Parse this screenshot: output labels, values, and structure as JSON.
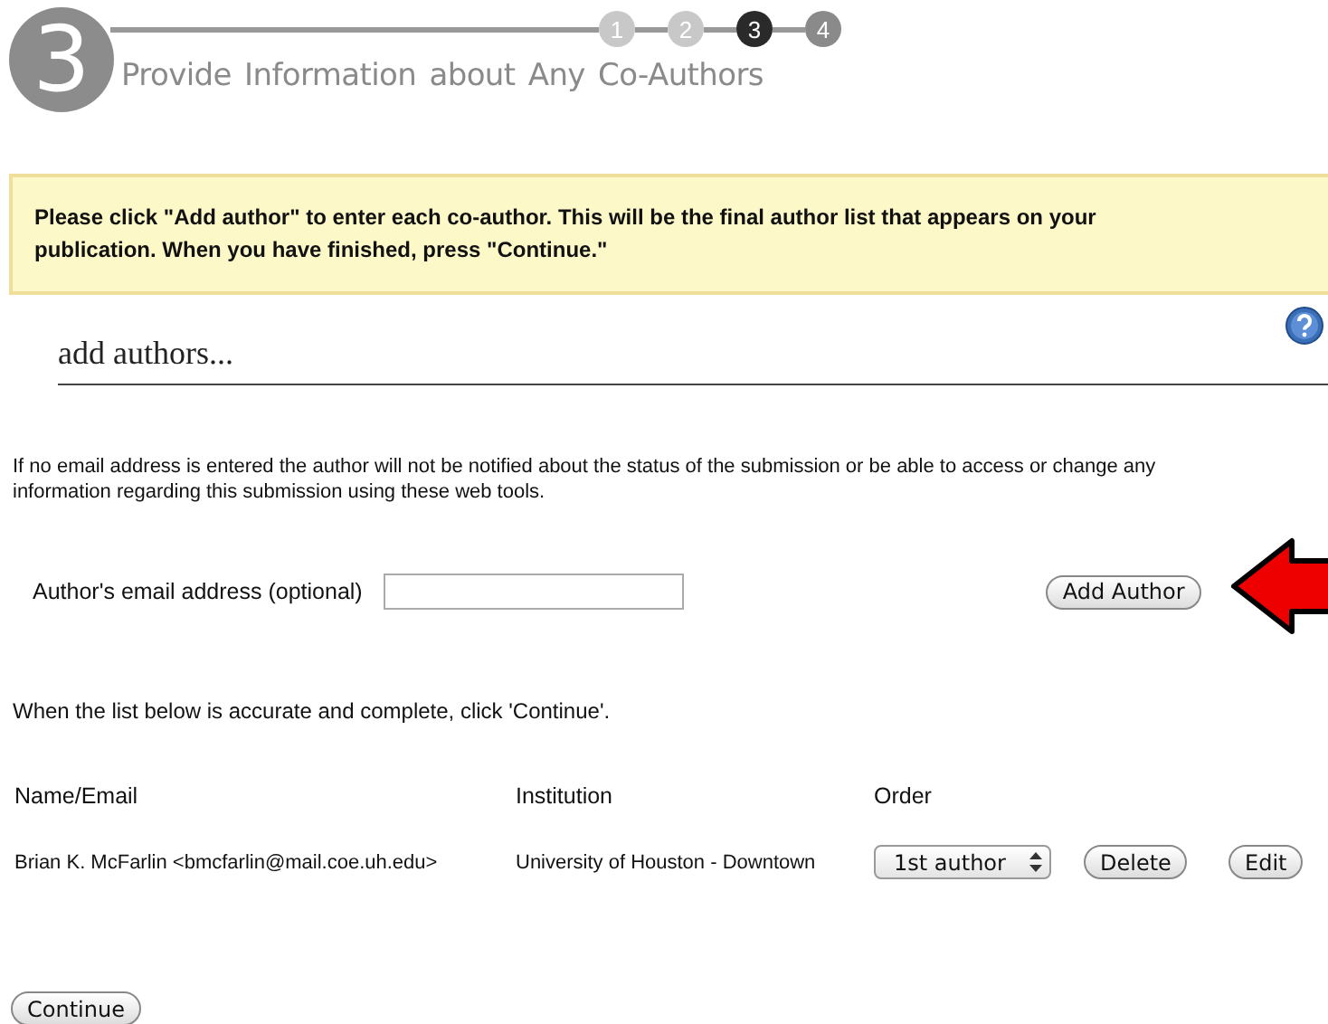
{
  "header": {
    "step_number": "3",
    "title": "Provide Information about Any Co-Authors",
    "steps": [
      {
        "label": "1",
        "completed": true,
        "selected": false
      },
      {
        "label": "2",
        "completed": true,
        "selected": false
      },
      {
        "label": "3",
        "completed": false,
        "selected": true
      },
      {
        "label": "4",
        "completed": false,
        "selected": false
      }
    ]
  },
  "notice": "Please click \"Add author\" to enter each co-author. This will be the final author list that appears on your publication. When you have finished, press \"Continue.\"",
  "section_title": "add authors...",
  "email_note": "If no email address is entered the author will not be notified about the status of the submission or be able to access or change any information regarding this submission using these web tools.",
  "email_field": {
    "label": "Author's email address (optional)"
  },
  "add_button": "Add Author",
  "list_note": "When the list below is accurate and complete, click 'Continue'.",
  "table": {
    "columns": [
      "Name/Email",
      "Institution",
      "Order"
    ],
    "rows": [
      {
        "name_email": "Brian K. McFarlin <bmcfarlin@mail.coe.uh.edu>",
        "institution": "University of Houston - Downtown",
        "order": "1st author",
        "actions": [
          "Delete",
          "Edit"
        ]
      }
    ]
  },
  "continue_button": "Continue"
}
